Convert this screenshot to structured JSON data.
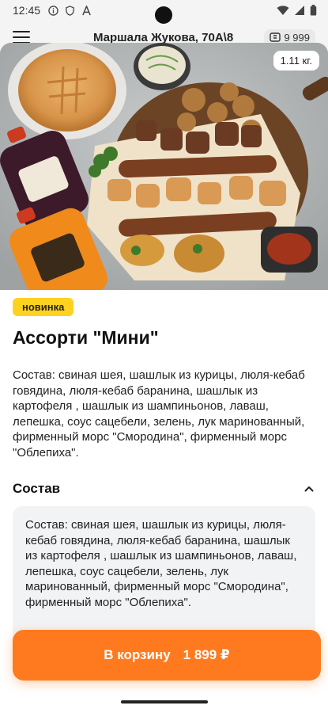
{
  "status_bar": {
    "time": "12:45"
  },
  "header": {
    "address": "Маршала Жукова, 70А\\8",
    "wallet_amount": "9 999"
  },
  "product": {
    "weight": "1.11 кг.",
    "tag": "новинка",
    "title": "Ассорти \"Мини\"",
    "description": "Состав: свиная шея, шашлык из курицы, люля-кебаб говядина, люля-кебаб баранина, шашлык из картофеля , шашлык из шампиньонов, лаваш, лепешка, соус сацебели, зелень, лук маринованный, фирменный морс \"Смородина\", фирменный морс \"Облепиха\"."
  },
  "composition": {
    "section_title": "Состав",
    "text": "Состав: свиная шея, шашлык из курицы, люля-кебаб говядина, люля-кебаб баранина, шашлык из картофеля , шашлык из шампиньонов, лаваш, лепешка, соус сацебели, зелень, лук маринованный, фирменный морс \"Смородина\", фирменный морс \"Облепиха\"."
  },
  "cart": {
    "label": "В корзину",
    "price": "1 899 ₽"
  },
  "icons": {
    "menu": "menu-icon",
    "wallet": "wallet-icon",
    "chevron": "chevron-up-icon"
  },
  "colors": {
    "accent": "#ff7a1f",
    "tag_bg": "#ffd21f",
    "card_bg": "#f2f3f5"
  }
}
